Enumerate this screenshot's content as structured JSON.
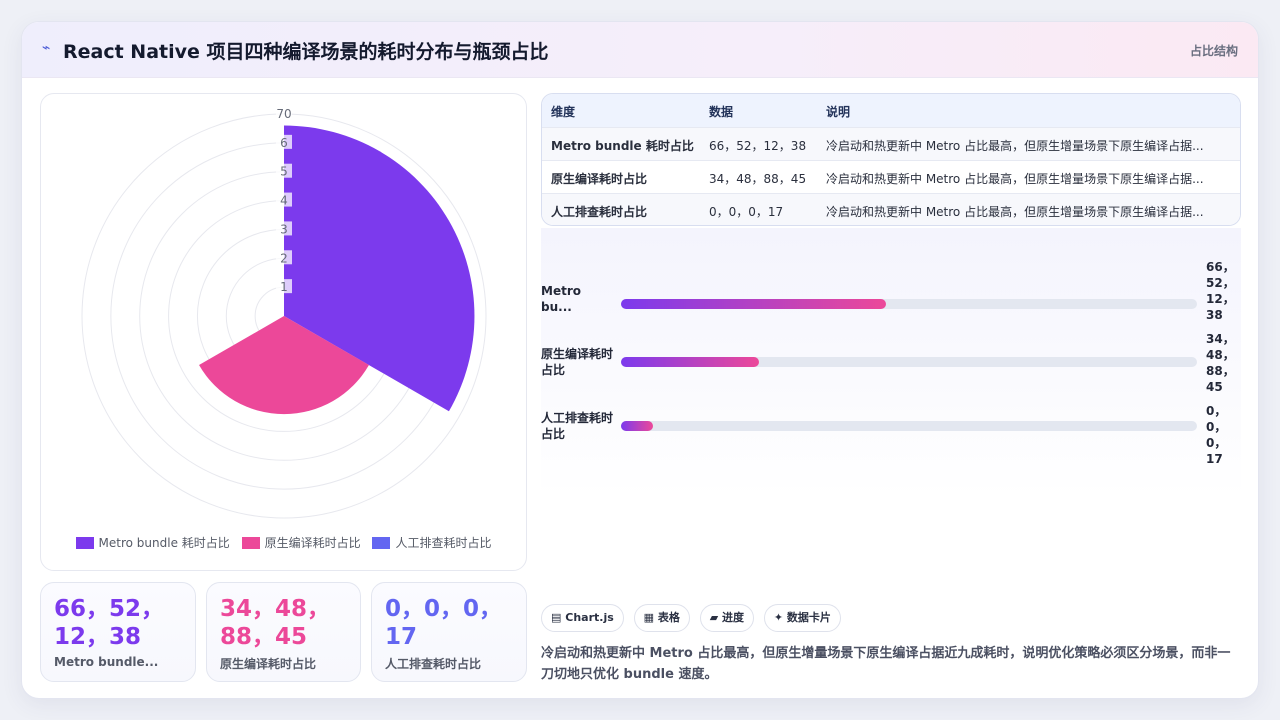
{
  "header": {
    "icon": "bolt-icon",
    "title": "React Native 项目四种编译场景的耗时分布与瓶颈占比",
    "tag": "占比结构"
  },
  "chart_data": {
    "type": "polarArea",
    "r_ticks": [
      1,
      2,
      3,
      4,
      5,
      6,
      70
    ],
    "r_max": 70,
    "series": [
      {
        "name": "Metro bundle 耗时占比",
        "value": 66,
        "color": "#7c3aed"
      },
      {
        "name": "原生编译耗时占比",
        "value": 34,
        "color": "#ec4899"
      },
      {
        "name": "人工排查耗时占比",
        "value": 0,
        "color": "#6366f1"
      }
    ],
    "legend": "bottom"
  },
  "stats": [
    {
      "value": "66，52，12，38",
      "label": "Metro bundle...",
      "color": "#7c3aed"
    },
    {
      "value": "34，48，88，45",
      "label": "原生编译耗时占比",
      "color": "#ec4899"
    },
    {
      "value": "0，0，0，17",
      "label": "人工排查耗时占比",
      "color": "#6366f1"
    }
  ],
  "table": {
    "headers": [
      "维度",
      "数据",
      "说明"
    ],
    "rows": [
      [
        "Metro bundle 耗时占比",
        "66，52，12，38",
        "冷启动和热更新中 Metro 占比最高，但原生增量场景下原生编译占据..."
      ],
      [
        "原生编译耗时占比",
        "34，48，88，45",
        "冷启动和热更新中 Metro 占比最高，但原生增量场景下原生编译占据..."
      ],
      [
        "人工排查耗时占比",
        "0，0，0，17",
        "冷启动和热更新中 Metro 占比最高，但原生增量场景下原生编译占据..."
      ]
    ]
  },
  "progress": [
    {
      "label": "Metro bu...",
      "value": "66，52，12，38",
      "percent": 46
    },
    {
      "label": "原生编译耗时占比",
      "value": "34，48，88，45",
      "percent": 24
    },
    {
      "label": "人工排查耗时占比",
      "value": "0，0，0，17",
      "percent": 5.5
    }
  ],
  "chips": [
    {
      "icon": "chart-icon",
      "label": "Chart.js"
    },
    {
      "icon": "table-icon",
      "label": "表格"
    },
    {
      "icon": "progress-icon",
      "label": "进度"
    },
    {
      "icon": "sparkle-icon",
      "label": "数据卡片"
    }
  ],
  "summary": "冷启动和热更新中 Metro 占比最高，但原生增量场景下原生编译占据近九成耗时，说明优化策略必须区分场景，而非一刀切地只优化 bundle 速度。"
}
